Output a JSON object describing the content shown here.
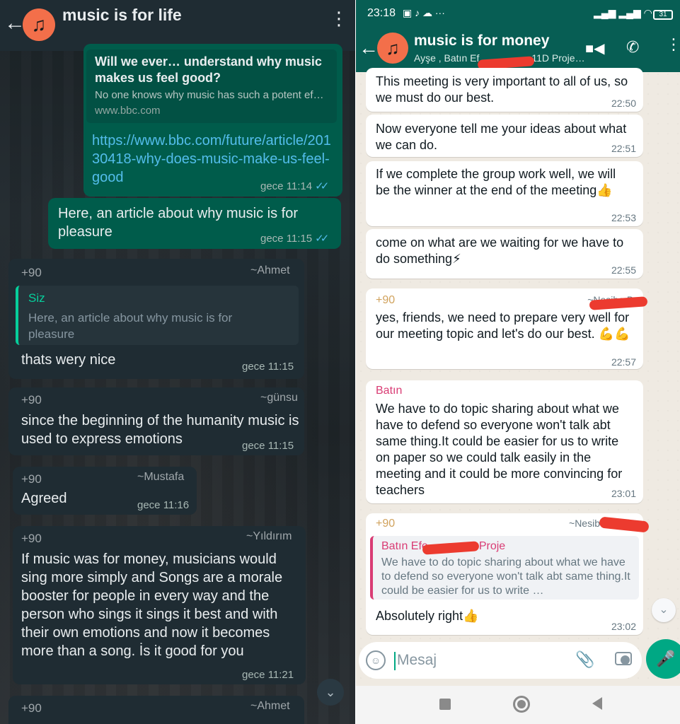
{
  "left": {
    "header": {
      "title": "music is for life",
      "avatar_icon": "music-note-icon"
    },
    "msg_link": {
      "title": "Will we ever… understand why music makes us feel good?",
      "desc": "No one knows why music has such a potent ef…",
      "domain": "www.bbc.com",
      "url": "https://www.bbc.com/future/article/20130418-why-does-music-make-us-feel-good",
      "time": "gece 11:14"
    },
    "msg_out2": {
      "text": "Here, an article about why music is for pleasure",
      "time": "gece 11:15"
    },
    "msg_ahmet": {
      "num": "+90",
      "name": "~Ahmet",
      "quote_name": "Siz",
      "quote_text": "Here, an article about why music is for pleasure",
      "text": "thats wery nice",
      "time": "gece 11:15"
    },
    "msg_gunsu": {
      "num": "+90",
      "name": "~günsu",
      "text": "since the beginning of the humanity music is used to express emotions",
      "time": "gece 11:15"
    },
    "msg_mustafa": {
      "num": "+90",
      "name": "~Mustafa",
      "text": "Agreed",
      "time": "gece 11:16"
    },
    "msg_yildirim": {
      "num": "+90",
      "name": "~Yıldırım",
      "text": "If music was for money, musicians would sing more simply and Songs are a morale booster for people in every way and the person who sings it sings it best and with their own emotions and now it becomes more than a song. İs it good for you",
      "time": "gece 11:21"
    },
    "msg_last": {
      "num": "+90",
      "name": "~Ahmet"
    },
    "colors": {
      "outgoing": "#005c4b",
      "incoming": "#1f2c33",
      "header": "#1f2c33"
    }
  },
  "right": {
    "status": {
      "time": "23:18",
      "battery": "31"
    },
    "header": {
      "title": "music is for money",
      "subtitle": "Ayşe , Batın Ef",
      "subtitle_tail": "11D Proje…"
    },
    "m1": {
      "text": "This meeting is very important to all of us, so we must do our best.",
      "time": "22:50"
    },
    "m2": {
      "text": "Now everyone tell me your ideas about what we can do.",
      "time": "22:51"
    },
    "m3": {
      "text": "If we complete the group work well, we will be the winner at the end of the meeting👍",
      "time": "22:53"
    },
    "m4": {
      "text": "come on what are we waiting for we have to do something⚡",
      "time": "22:55"
    },
    "m5": {
      "num": "+90",
      "name": "~Nesibe Be",
      "text": "yes, friends, we need to prepare very well for our meeting topic and let's do our best. 💪💪",
      "time": "22:57"
    },
    "m6": {
      "sender": "Batın",
      "text": "We have to do topic sharing about what we have to defend so everyone won't talk abt same thing.It could be easier for us to write on paper so we could talk easily in the meeting and it could be more convincing for teachers",
      "time": "23:01"
    },
    "m7": {
      "num": "+90",
      "name": "~Nesibe B",
      "quote_name": "Batın Efe",
      "quote_tail": "Proje",
      "quote_text": "We have to do topic sharing about what we have to defend so everyone won't talk abt same thing.It could be easier for us to write …",
      "text": "Absolutely right👍",
      "time": "23:02"
    },
    "input": {
      "placeholder": "Mesaj"
    },
    "colors": {
      "accent": "#075e54",
      "send": "#00a884",
      "bubble": "#ffffff"
    }
  }
}
